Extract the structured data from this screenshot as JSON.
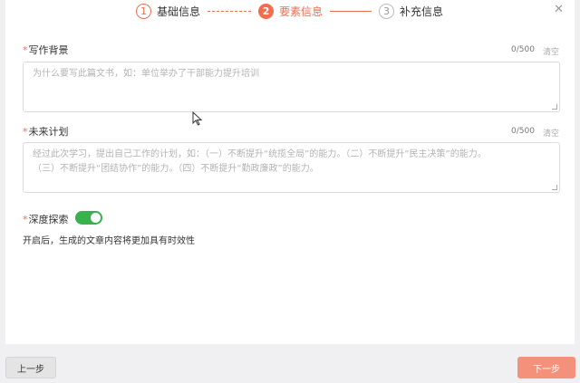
{
  "stepper": {
    "steps": [
      {
        "num": "1",
        "label": "基础信息",
        "state": "done"
      },
      {
        "num": "2",
        "label": "要素信息",
        "state": "active"
      },
      {
        "num": "3",
        "label": "补充信息",
        "state": "todo"
      }
    ],
    "close_icon": "✕"
  },
  "form": {
    "background": {
      "required_mark": "*",
      "label": "写作背景",
      "counter": "0/500",
      "clear": "清空",
      "placeholder": "为什么要写此篇文书，如：单位举办了干部能力提升培训"
    },
    "plan": {
      "required_mark": "*",
      "label": "未来计划",
      "counter": "0/500",
      "clear": "清空",
      "placeholder_line1": "经过此次学习，提出自己工作的计划，如：（一）不断提升“统揽全局”的能力。（二）不断提升“民主决策”的能力。",
      "placeholder_line2": "（三）不断提升“团结协作”的能力。（四）不断提升“勤政廉政”的能力。"
    },
    "deep_search": {
      "required_mark": "*",
      "label": "深度探索",
      "enabled": true,
      "hint": "开启后，生成的文章内容将更加具有时效性"
    }
  },
  "footer": {
    "prev_label": "上一步",
    "next_label": "下一步"
  },
  "colors": {
    "accent": "#f06d4f",
    "toggle_on": "#37b24d",
    "next_button": "#f3917a"
  }
}
